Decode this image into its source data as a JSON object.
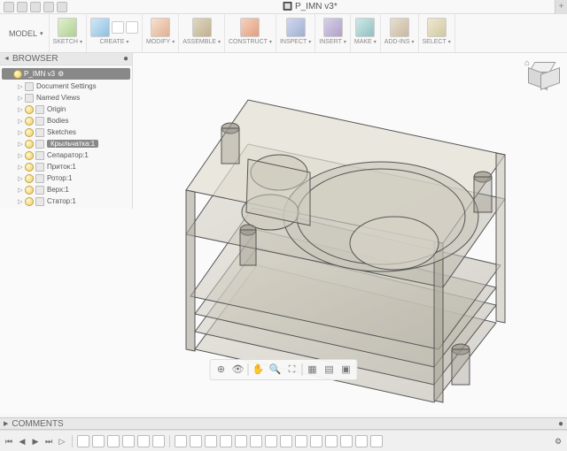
{
  "window": {
    "title": "P_IMN v3*"
  },
  "ribbon": {
    "model": "MODEL",
    "groups": [
      {
        "label": "SKETCH"
      },
      {
        "label": "CREATE"
      },
      {
        "label": "MODIFY"
      },
      {
        "label": "ASSEMBLE"
      },
      {
        "label": "CONSTRUCT"
      },
      {
        "label": "INSPECT"
      },
      {
        "label": "INSERT"
      },
      {
        "label": "MAKE"
      },
      {
        "label": "ADD-INS"
      },
      {
        "label": "SELECT"
      }
    ]
  },
  "browser": {
    "title": "BROWSER",
    "root": "P_IMN v3",
    "items": [
      {
        "label": "Document Settings"
      },
      {
        "label": "Named Views"
      },
      {
        "label": "Origin"
      },
      {
        "label": "Bodies"
      },
      {
        "label": "Sketches"
      },
      {
        "label": "Крыльчатка:1"
      },
      {
        "label": "Сепаратор:1"
      },
      {
        "label": "Приток:1"
      },
      {
        "label": "Ротор:1"
      },
      {
        "label": "Верх:1"
      },
      {
        "label": "Статор:1"
      }
    ]
  },
  "comments": {
    "title": "COMMENTS"
  }
}
